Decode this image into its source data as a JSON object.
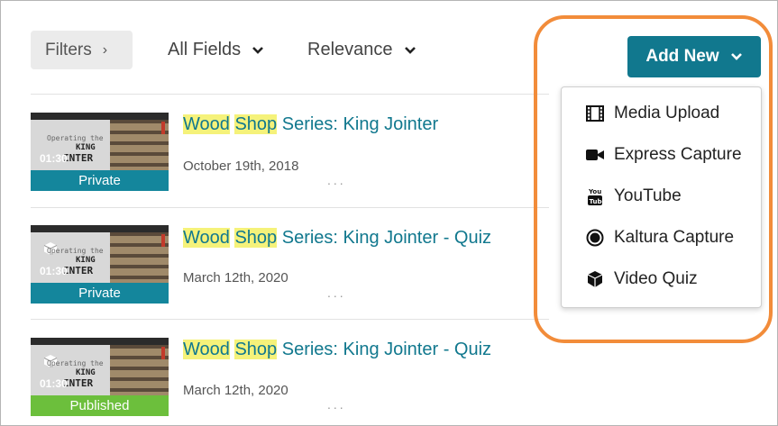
{
  "toolbar": {
    "filters_label": "Filters",
    "fields_label": "All Fields",
    "sort_label": "Relevance",
    "add_new_label": "Add New"
  },
  "add_new_menu": [
    {
      "label": "Media Upload",
      "icon": "film-icon"
    },
    {
      "label": "Express Capture",
      "icon": "video-camera-icon"
    },
    {
      "label": "YouTube",
      "icon": "youtube-icon"
    },
    {
      "label": "Kaltura Capture",
      "icon": "record-circle-icon"
    },
    {
      "label": "Video Quiz",
      "icon": "cube-icon"
    }
  ],
  "entries": [
    {
      "title_hl1": "Wood",
      "title_sp": " ",
      "title_hl2": "Shop",
      "title_rest": " Series: King Jointer",
      "date": "October 19th, 2018",
      "status": "Private",
      "status_color": "#14869c",
      "duration": "01:30",
      "thumb_line1": "Operating the",
      "thumb_line2": "KING",
      "thumb_line3": "INTER",
      "more": "...",
      "quiz": false
    },
    {
      "title_hl1": "Wood",
      "title_sp": " ",
      "title_hl2": "Shop",
      "title_rest": " Series: King Jointer - Quiz",
      "date": "March 12th, 2020",
      "status": "Private",
      "status_color": "#14869c",
      "duration": "01:30",
      "thumb_line1": "Operating the",
      "thumb_line2": "KING",
      "thumb_line3": "INTER",
      "more": "...",
      "quiz": true
    },
    {
      "title_hl1": "Wood",
      "title_sp": " ",
      "title_hl2": "Shop",
      "title_rest": " Series: King Jointer - Quiz",
      "date": "March 12th, 2020",
      "status": "Published",
      "status_color": "#6cbf3c",
      "duration": "01:30",
      "thumb_line1": "Operating the",
      "thumb_line2": "KING",
      "thumb_line3": "INTER",
      "more": "...",
      "quiz": true
    }
  ],
  "colors": {
    "accent": "#11788e",
    "highlight": "#f5f27a",
    "callout": "#f28c3a"
  }
}
